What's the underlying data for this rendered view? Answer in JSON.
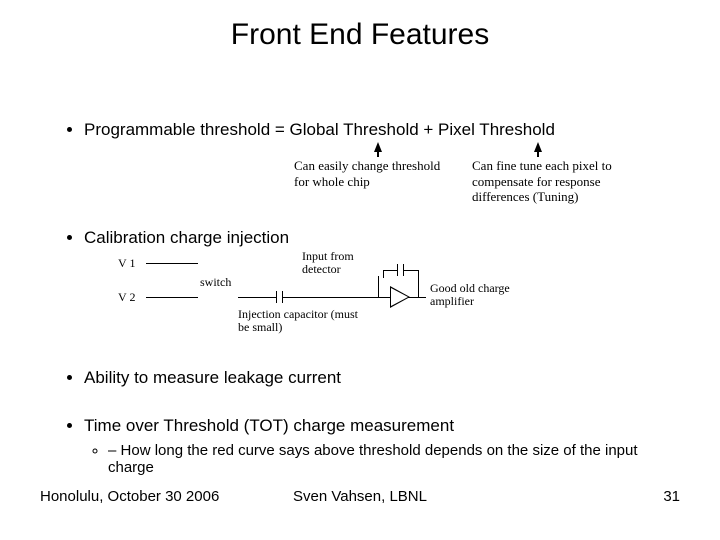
{
  "title": "Front End Features",
  "bullets": {
    "b1": "Programmable threshold = Global Threshold + Pixel Threshold",
    "b2": "Calibration charge injection",
    "b3": "Ability to measure leakage current",
    "b4": "Time over Threshold (TOT) charge measurement",
    "b4_sub": "How long the red curve says above threshold depends on the size of the input charge"
  },
  "annotations": {
    "global": "Can easily change threshold for whole chip",
    "pixel": "Can fine tune each pixel to compensate for response differences (Tuning)"
  },
  "diagram": {
    "v1": "V 1",
    "v2": "V 2",
    "switch": "switch",
    "input_from_detector": "Input from detector",
    "injection_capacitor": "Injection capacitor (must be small)",
    "amplifier": "Good old charge amplifier"
  },
  "footer": {
    "left": "Honolulu, October 30 2006",
    "center": "Sven Vahsen, LBNL",
    "page": "31"
  }
}
